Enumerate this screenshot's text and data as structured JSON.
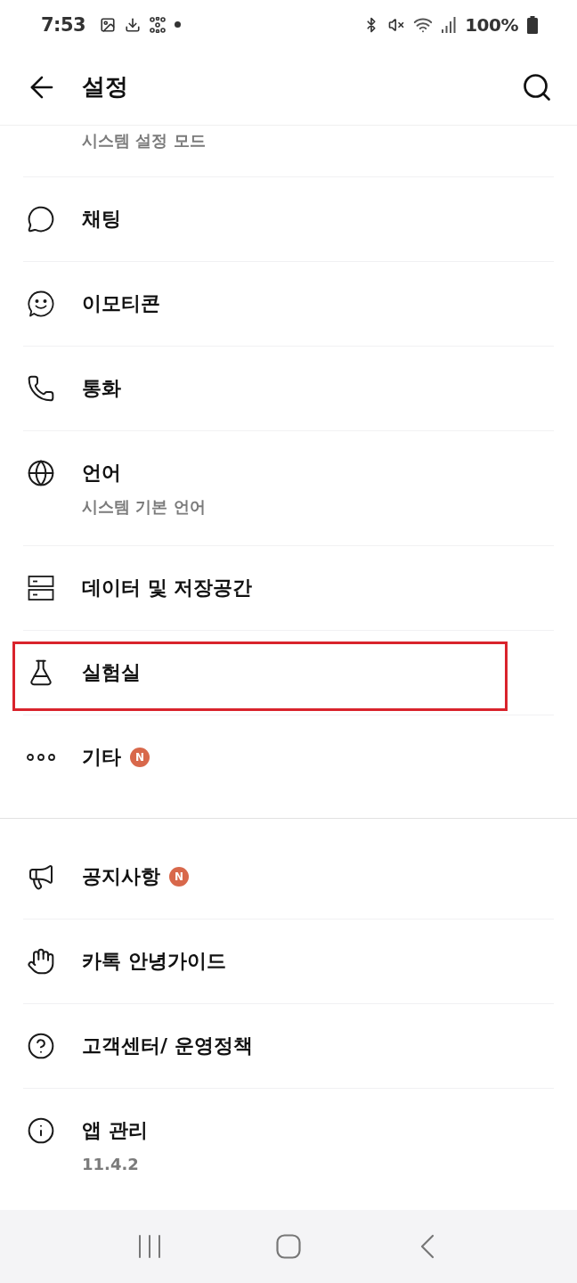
{
  "status_bar": {
    "time": "7:53",
    "battery": "100%"
  },
  "app_bar": {
    "title": "설정"
  },
  "sections": [
    {
      "items": [
        {
          "kind": "partial",
          "subtitle": "시스템 설정 모드",
          "highlighted": false
        },
        {
          "kind": "item",
          "title": "채팅",
          "highlighted": false
        },
        {
          "kind": "item",
          "title": "이모티콘",
          "highlighted": false
        },
        {
          "kind": "item",
          "title": "통화",
          "highlighted": false
        },
        {
          "kind": "item",
          "title": "언어",
          "subtitle": "시스템 기본 언어",
          "highlighted": false
        },
        {
          "kind": "item",
          "title": "데이터 및 저장공간",
          "highlighted": false
        },
        {
          "kind": "item",
          "title": "실험실",
          "highlighted": true
        },
        {
          "kind": "item",
          "title": "기타",
          "badge": "N",
          "highlighted": false
        }
      ]
    },
    {
      "items": [
        {
          "kind": "item",
          "title": "공지사항",
          "badge": "N",
          "highlighted": false
        },
        {
          "kind": "item",
          "title": "카톡 안녕가이드",
          "highlighted": false
        },
        {
          "kind": "item",
          "title": "고객센터/ 운영정책",
          "highlighted": false
        },
        {
          "kind": "item",
          "title": "앱 관리",
          "subtitle": "11.4.2",
          "highlighted": false
        }
      ]
    }
  ]
}
